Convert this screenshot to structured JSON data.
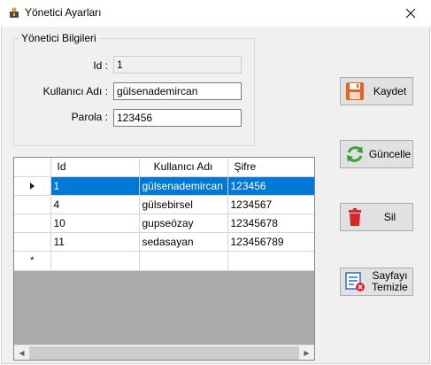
{
  "window": {
    "title": "Yönetici Ayarları",
    "icon": "user-lock-icon",
    "close_glyph": "✕"
  },
  "group": {
    "legend": "Yönetici Bilgileri",
    "id_label": "Id :",
    "id_value": "1",
    "user_label": "Kullanıcı Adı :",
    "user_value": "gülsenademircan",
    "password_label": "Parola :",
    "password_value": "123456"
  },
  "grid": {
    "columns": [
      "Id",
      "Kullanıcı Adı",
      "Şifre"
    ],
    "rows": [
      {
        "id": "1",
        "user": "gülsenademircan",
        "password": "123456",
        "selected": true
      },
      {
        "id": "4",
        "user": "gülsebirsel",
        "password": "1234567",
        "selected": false
      },
      {
        "id": "10",
        "user": "gupseözay",
        "password": "12345678",
        "selected": false
      },
      {
        "id": "11",
        "user": "sedasayan",
        "password": "123456789",
        "selected": false
      }
    ],
    "new_row_marker": "*"
  },
  "buttons": {
    "save": "Kaydet",
    "update": "Güncelle",
    "delete": "Sil",
    "clear_line1": "Sayfayı",
    "clear_line2": "Temizle"
  },
  "colors": {
    "selection": "#0078d7",
    "save_icon": "#e8621a",
    "update_icon": "#3aa13a",
    "delete_icon": "#d9262c"
  }
}
